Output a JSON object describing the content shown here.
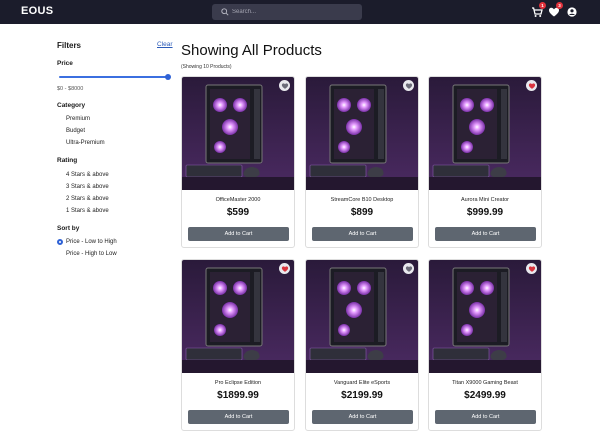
{
  "navbar": {
    "brand": "EOUS",
    "search_placeholder": "Search...",
    "cart_badge": "1",
    "wishlist_badge": "3"
  },
  "sidebar": {
    "title": "Filters",
    "clear": "Clear",
    "price": {
      "title": "Price",
      "range_text": "$0 - $8000",
      "max_value_fraction": 1.0
    },
    "category": {
      "title": "Category",
      "options": [
        "Premium",
        "Budget",
        "Ultra-Premium"
      ]
    },
    "rating": {
      "title": "Rating",
      "options": [
        "4 Stars & above",
        "3 Stars & above",
        "2 Stars & above",
        "1 Stars & above"
      ]
    },
    "sort": {
      "title": "Sort by",
      "options": [
        "Price - Low to High",
        "Price - High to Low"
      ],
      "selected": "Price - Low to High"
    }
  },
  "main": {
    "title": "Showing All Products",
    "count_text": "(Showing 10 Products)",
    "add_to_cart_label": "Add to Cart",
    "products": [
      {
        "name": "OfficeMaster 2000",
        "price": "$599",
        "favorited": false
      },
      {
        "name": "StreamCore B10 Desktop",
        "price": "$899",
        "favorited": false
      },
      {
        "name": "Aurora Mini Creator",
        "price": "$999.99",
        "favorited": true
      },
      {
        "name": "Pro Eclipse Edition",
        "price": "$1899.99",
        "favorited": true
      },
      {
        "name": "Vanguard Elite eSports",
        "price": "$2199.99",
        "favorited": false
      },
      {
        "name": "Titan X9000 Gaming Beast",
        "price": "$2499.99",
        "favorited": true
      }
    ]
  },
  "colors": {
    "navbar_bg": "#1b1c2b",
    "accent_blue": "#2f62d6",
    "heart_red": "#d9343e",
    "button_gray": "#5e6670"
  }
}
